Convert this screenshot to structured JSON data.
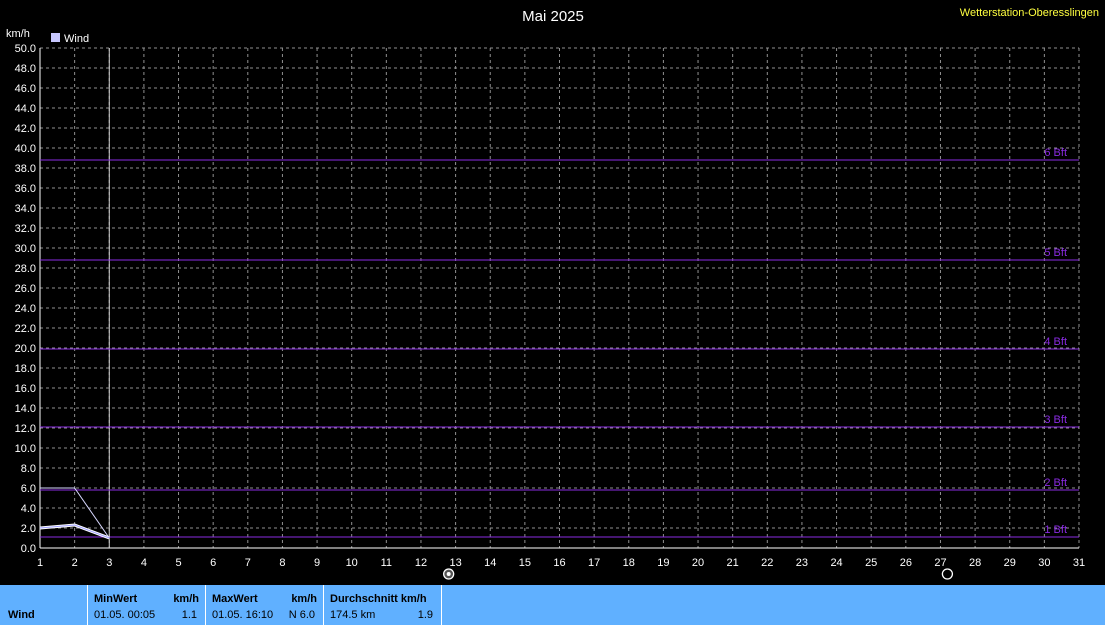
{
  "header": {
    "title": "Mai 2025",
    "station": "Wetterstation-Oberesslingen"
  },
  "legend": {
    "label": "Wind",
    "color": "#c8c8ff"
  },
  "colors": {
    "grid": "#909090",
    "beaufort": "#8a2be2",
    "line": "#ffffff",
    "axis_text": "#ffffff"
  },
  "chart_data": {
    "type": "line",
    "title": "Mai 2025",
    "ylabel": "km/h",
    "xlabel": "",
    "xlim": [
      1,
      31
    ],
    "ylim": [
      0,
      50
    ],
    "grid": true,
    "legend_position": "top-left",
    "x_ticks": [
      1,
      2,
      3,
      4,
      5,
      6,
      7,
      8,
      9,
      10,
      11,
      12,
      13,
      14,
      15,
      16,
      17,
      18,
      19,
      20,
      21,
      22,
      23,
      24,
      25,
      26,
      27,
      28,
      29,
      30,
      31
    ],
    "y_ticks": [
      "0.0",
      "2.0",
      "4.0",
      "6.0",
      "8.0",
      "10.0",
      "12.0",
      "14.0",
      "16.0",
      "18.0",
      "20.0",
      "22.0",
      "24.0",
      "26.0",
      "28.0",
      "30.0",
      "32.0",
      "34.0",
      "36.0",
      "38.0",
      "40.0",
      "42.0",
      "44.0",
      "46.0",
      "48.0",
      "50.0"
    ],
    "series": [
      {
        "name": "Wind",
        "x": [
          1,
          2,
          3
        ],
        "y": [
          2.0,
          2.3,
          1.0
        ]
      },
      {
        "x": [
          1,
          2,
          3
        ],
        "y": [
          6.0,
          6.0,
          1.0
        ]
      },
      {
        "x": [
          1,
          2,
          3
        ],
        "y": [
          2.0,
          2.3,
          1.0
        ]
      }
    ],
    "beaufort_lines": [
      {
        "label": "1 Bft",
        "value": 1.1
      },
      {
        "label": "2 Bft",
        "value": 5.8
      },
      {
        "label": "3 Bft",
        "value": 12.1
      },
      {
        "label": "4 Bft",
        "value": 19.9
      },
      {
        "label": "5 Bft",
        "value": 28.8
      },
      {
        "label": "6 Bft",
        "value": 38.8
      }
    ],
    "moon_markers": [
      {
        "day": 12.8,
        "symbol": "full-moon-icon"
      },
      {
        "day": 27.2,
        "symbol": "new-moon-icon"
      }
    ]
  },
  "footer": {
    "row_label": "Wind",
    "min": {
      "header": "MinWert",
      "unit": "km/h",
      "date": "01.05.  00:05",
      "value": "1.1"
    },
    "max": {
      "header": "MaxWert",
      "unit": "km/h",
      "date": "01.05.  16:10",
      "value": "N 6.0"
    },
    "avg": {
      "header": "Durchschnitt km/h",
      "sub": "174.5 km",
      "value": "1.9"
    }
  }
}
